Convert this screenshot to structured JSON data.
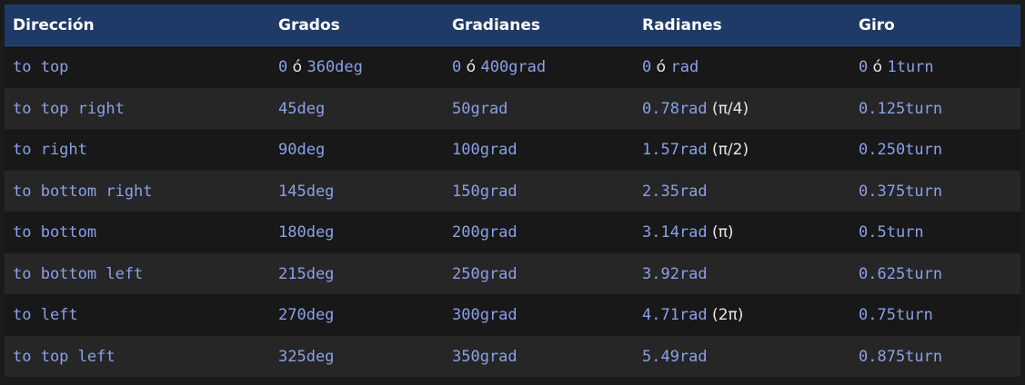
{
  "headers": [
    "Dirección",
    "Grados",
    "Gradianes",
    "Radianes",
    "Giro"
  ],
  "rows": [
    {
      "direction": "to top",
      "degrees": [
        {
          "t": "0",
          "m": true
        },
        {
          "t": " ó ",
          "m": false
        },
        {
          "t": "360deg",
          "m": true
        }
      ],
      "gradians": [
        {
          "t": "0",
          "m": true
        },
        {
          "t": " ó ",
          "m": false
        },
        {
          "t": "400grad",
          "m": true
        }
      ],
      "radians": [
        {
          "t": "0",
          "m": true
        },
        {
          "t": " ó ",
          "m": false
        },
        {
          "t": "rad",
          "m": true
        }
      ],
      "turns": [
        {
          "t": "0",
          "m": true
        },
        {
          "t": " ó ",
          "m": false
        },
        {
          "t": "1turn",
          "m": true
        }
      ]
    },
    {
      "direction": "to top right",
      "degrees": [
        {
          "t": "45deg",
          "m": true
        }
      ],
      "gradians": [
        {
          "t": "50grad",
          "m": true
        }
      ],
      "radians": [
        {
          "t": "0.78rad",
          "m": true
        },
        {
          "t": " (π/4)",
          "m": false
        }
      ],
      "turns": [
        {
          "t": "0.125turn",
          "m": true
        }
      ]
    },
    {
      "direction": "to right",
      "degrees": [
        {
          "t": "90deg",
          "m": true
        }
      ],
      "gradians": [
        {
          "t": "100grad",
          "m": true
        }
      ],
      "radians": [
        {
          "t": "1.57rad",
          "m": true
        },
        {
          "t": " (π/2)",
          "m": false
        }
      ],
      "turns": [
        {
          "t": "0.250turn",
          "m": true
        }
      ]
    },
    {
      "direction": "to bottom right",
      "degrees": [
        {
          "t": "145deg",
          "m": true
        }
      ],
      "gradians": [
        {
          "t": "150grad",
          "m": true
        }
      ],
      "radians": [
        {
          "t": "2.35rad",
          "m": true
        }
      ],
      "turns": [
        {
          "t": "0.375turn",
          "m": true
        }
      ]
    },
    {
      "direction": "to bottom",
      "degrees": [
        {
          "t": "180deg",
          "m": true
        }
      ],
      "gradians": [
        {
          "t": "200grad",
          "m": true
        }
      ],
      "radians": [
        {
          "t": "3.14rad",
          "m": true
        },
        {
          "t": " (π)",
          "m": false
        }
      ],
      "turns": [
        {
          "t": "0.5turn",
          "m": true
        }
      ]
    },
    {
      "direction": "to bottom left",
      "degrees": [
        {
          "t": "215deg",
          "m": true
        }
      ],
      "gradians": [
        {
          "t": "250grad",
          "m": true
        }
      ],
      "radians": [
        {
          "t": "3.92rad",
          "m": true
        }
      ],
      "turns": [
        {
          "t": "0.625turn",
          "m": true
        }
      ]
    },
    {
      "direction": "to left",
      "degrees": [
        {
          "t": "270deg",
          "m": true
        }
      ],
      "gradians": [
        {
          "t": "300grad",
          "m": true
        }
      ],
      "radians": [
        {
          "t": "4.71rad",
          "m": true
        },
        {
          "t": " (2π)",
          "m": false
        }
      ],
      "turns": [
        {
          "t": "0.75turn",
          "m": true
        }
      ]
    },
    {
      "direction": "to top left",
      "degrees": [
        {
          "t": "325deg",
          "m": true
        }
      ],
      "gradians": [
        {
          "t": "350grad",
          "m": true
        }
      ],
      "radians": [
        {
          "t": "5.49rad",
          "m": true
        }
      ],
      "turns": [
        {
          "t": "0.875turn",
          "m": true
        }
      ]
    }
  ],
  "colors": {
    "header_bg": "#1f3a66",
    "code_text": "#8ba0e8",
    "plain_text": "#e6e6e6",
    "row_dark": "#181818",
    "row_light": "#262626"
  }
}
